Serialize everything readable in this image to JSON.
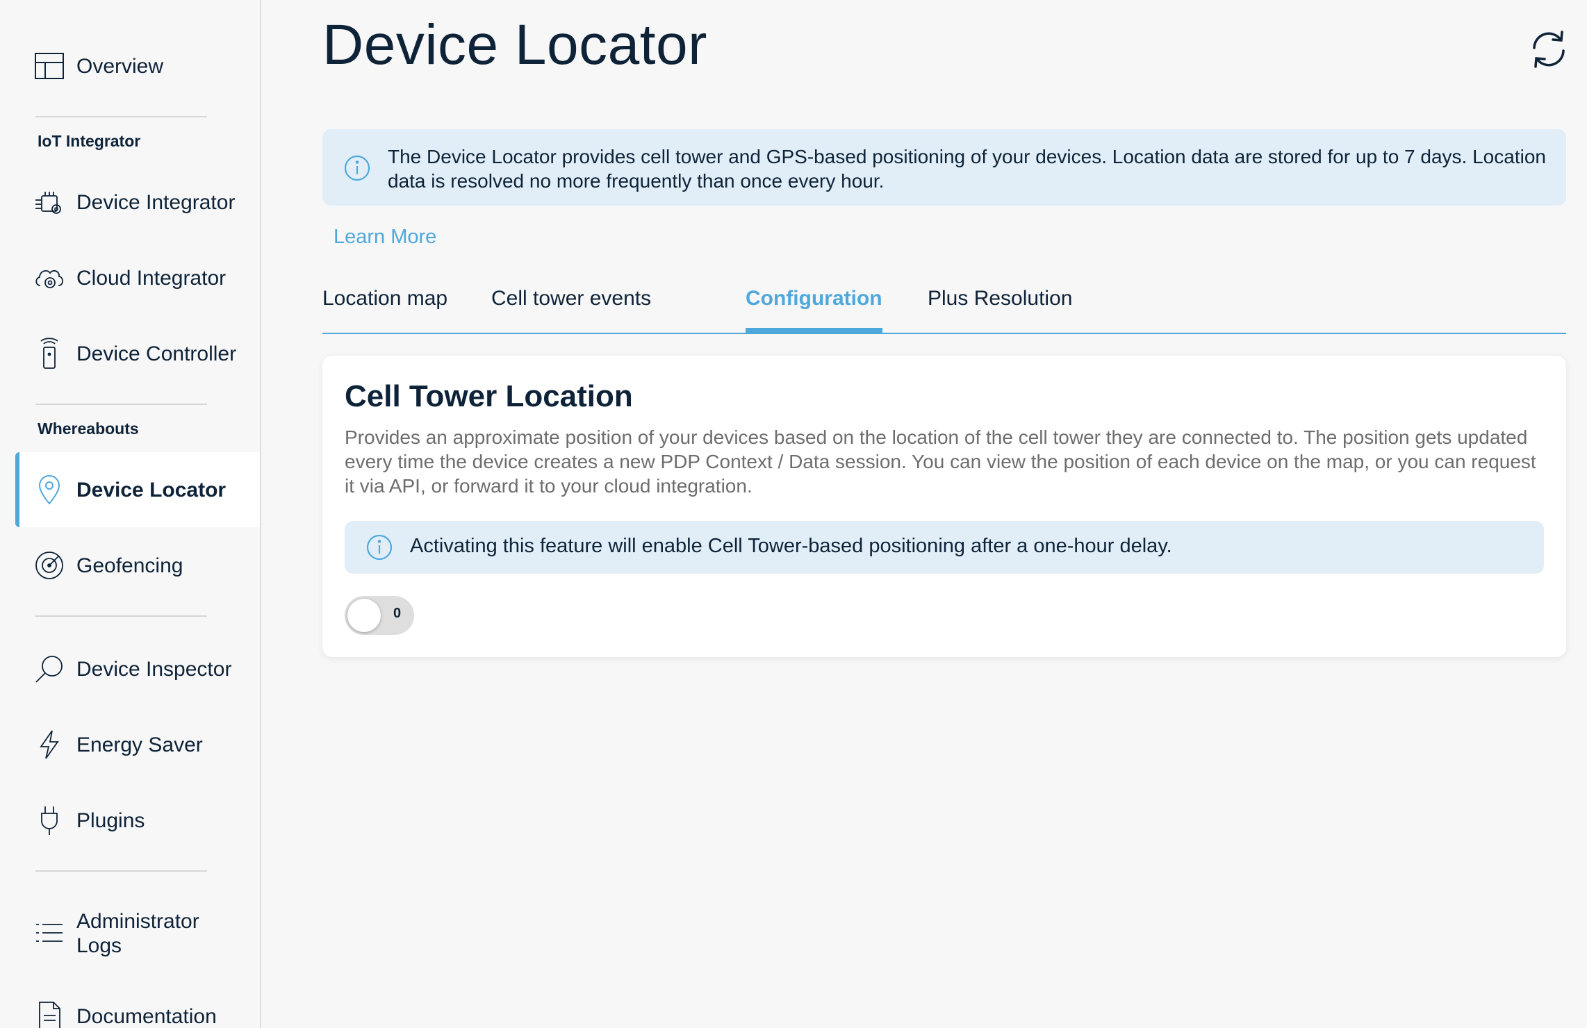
{
  "sidebar": {
    "items": [
      {
        "label": "Overview",
        "icon": "layout-icon"
      },
      {
        "label": "Device Integrator",
        "icon": "device-integrator-icon"
      },
      {
        "label": "Cloud Integrator",
        "icon": "cloud-gear-icon"
      },
      {
        "label": "Device Controller",
        "icon": "remote-control-icon"
      },
      {
        "label": "Device Locator",
        "icon": "location-pin-icon",
        "active": true
      },
      {
        "label": "Geofencing",
        "icon": "radar-icon"
      },
      {
        "label": "Device Inspector",
        "icon": "magnifier-icon"
      },
      {
        "label": "Energy Saver",
        "icon": "lightning-icon"
      },
      {
        "label": "Plugins",
        "icon": "plug-icon"
      },
      {
        "label": "Administrator Logs",
        "icon": "list-icon"
      },
      {
        "label": "Documentation",
        "icon": "document-icon"
      }
    ],
    "sections": {
      "iot_integrator": "IoT Integrator",
      "whereabouts": "Whereabouts"
    }
  },
  "header": {
    "title": "Device Locator"
  },
  "info_banner": {
    "text": "The Device Locator provides cell tower and GPS-based positioning of your devices. Location data are stored for up to 7 days. Location data is resolved no more frequently than once every hour."
  },
  "learn_more": "Learn More",
  "tabs": [
    {
      "label": "Location map"
    },
    {
      "label": "Cell tower events"
    },
    {
      "label": "Configuration",
      "active": true
    },
    {
      "label": "Plus Resolution"
    }
  ],
  "card": {
    "title": "Cell Tower Location",
    "description": "Provides an approximate position of your devices based on the location of the cell tower they are connected to. The position gets updated every time the device creates a new PDP Context / Data session. You can view the position of each device on the map, or you can request it via API, or forward it to your cloud integration.",
    "banner_text": "Activating this feature will enable Cell Tower-based positioning after a one-hour delay.",
    "toggle_value": "0",
    "toggle_on": false
  },
  "colors": {
    "accent": "#4ea8dc",
    "text": "#0e2338",
    "banner_bg": "#e1eef7",
    "page_bg": "#f7f7f7"
  }
}
